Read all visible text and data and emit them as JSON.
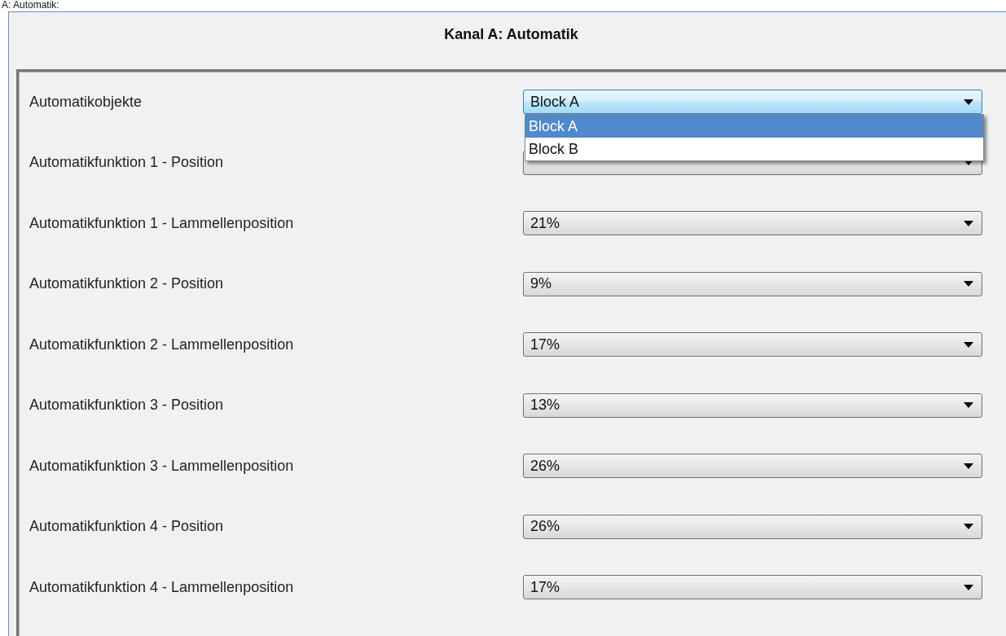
{
  "caption": "A: Automatik:",
  "window": {
    "title": "Kanal A: Automatik"
  },
  "parameters": [
    {
      "label": "Automatikobjekte",
      "value": "Block A",
      "focused": true,
      "options": [
        {
          "label": "Block A",
          "selected": true
        },
        {
          "label": "Block B",
          "selected": false
        }
      ]
    },
    {
      "label": "Automatikfunktion 1 - Position",
      "focused": false
    },
    {
      "label": "Automatikfunktion 1 - Lammellenposition",
      "value": "21%",
      "focused": false
    },
    {
      "label": "Automatikfunktion 2 - Position",
      "value": "9%",
      "focused": false
    },
    {
      "label": "Automatikfunktion 2 - Lammellenposition",
      "value": "17%",
      "focused": false
    },
    {
      "label": "Automatikfunktion 3 - Position",
      "value": "13%",
      "focused": false
    },
    {
      "label": "Automatikfunktion 3 - Lammellenposition",
      "value": "26%",
      "focused": false
    },
    {
      "label": "Automatikfunktion 4 - Position",
      "value": "26%",
      "focused": false
    },
    {
      "label": "Automatikfunktion 4 - Lammellenposition",
      "value": "17%",
      "focused": false
    }
  ]
}
